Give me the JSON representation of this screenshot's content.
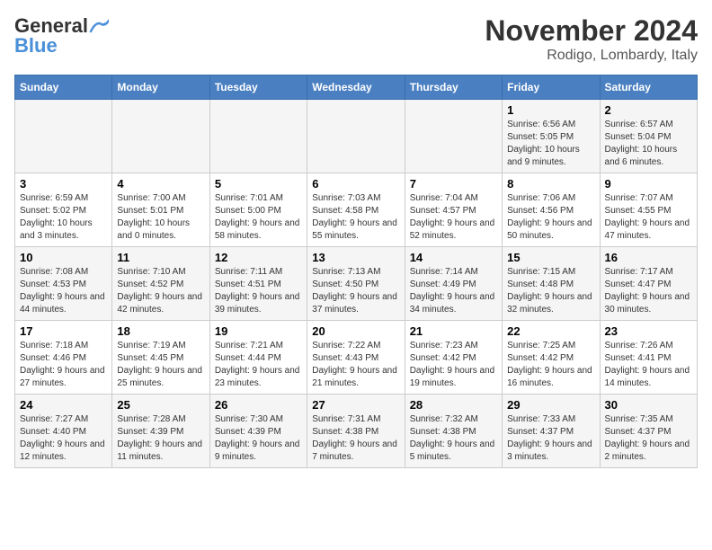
{
  "header": {
    "logo_general": "General",
    "logo_blue": "Blue",
    "month_title": "November 2024",
    "location": "Rodigo, Lombardy, Italy"
  },
  "days_of_week": [
    "Sunday",
    "Monday",
    "Tuesday",
    "Wednesday",
    "Thursday",
    "Friday",
    "Saturday"
  ],
  "weeks": [
    [
      {
        "day": "",
        "info": ""
      },
      {
        "day": "",
        "info": ""
      },
      {
        "day": "",
        "info": ""
      },
      {
        "day": "",
        "info": ""
      },
      {
        "day": "",
        "info": ""
      },
      {
        "day": "1",
        "info": "Sunrise: 6:56 AM\nSunset: 5:05 PM\nDaylight: 10 hours and 9 minutes."
      },
      {
        "day": "2",
        "info": "Sunrise: 6:57 AM\nSunset: 5:04 PM\nDaylight: 10 hours and 6 minutes."
      }
    ],
    [
      {
        "day": "3",
        "info": "Sunrise: 6:59 AM\nSunset: 5:02 PM\nDaylight: 10 hours and 3 minutes."
      },
      {
        "day": "4",
        "info": "Sunrise: 7:00 AM\nSunset: 5:01 PM\nDaylight: 10 hours and 0 minutes."
      },
      {
        "day": "5",
        "info": "Sunrise: 7:01 AM\nSunset: 5:00 PM\nDaylight: 9 hours and 58 minutes."
      },
      {
        "day": "6",
        "info": "Sunrise: 7:03 AM\nSunset: 4:58 PM\nDaylight: 9 hours and 55 minutes."
      },
      {
        "day": "7",
        "info": "Sunrise: 7:04 AM\nSunset: 4:57 PM\nDaylight: 9 hours and 52 minutes."
      },
      {
        "day": "8",
        "info": "Sunrise: 7:06 AM\nSunset: 4:56 PM\nDaylight: 9 hours and 50 minutes."
      },
      {
        "day": "9",
        "info": "Sunrise: 7:07 AM\nSunset: 4:55 PM\nDaylight: 9 hours and 47 minutes."
      }
    ],
    [
      {
        "day": "10",
        "info": "Sunrise: 7:08 AM\nSunset: 4:53 PM\nDaylight: 9 hours and 44 minutes."
      },
      {
        "day": "11",
        "info": "Sunrise: 7:10 AM\nSunset: 4:52 PM\nDaylight: 9 hours and 42 minutes."
      },
      {
        "day": "12",
        "info": "Sunrise: 7:11 AM\nSunset: 4:51 PM\nDaylight: 9 hours and 39 minutes."
      },
      {
        "day": "13",
        "info": "Sunrise: 7:13 AM\nSunset: 4:50 PM\nDaylight: 9 hours and 37 minutes."
      },
      {
        "day": "14",
        "info": "Sunrise: 7:14 AM\nSunset: 4:49 PM\nDaylight: 9 hours and 34 minutes."
      },
      {
        "day": "15",
        "info": "Sunrise: 7:15 AM\nSunset: 4:48 PM\nDaylight: 9 hours and 32 minutes."
      },
      {
        "day": "16",
        "info": "Sunrise: 7:17 AM\nSunset: 4:47 PM\nDaylight: 9 hours and 30 minutes."
      }
    ],
    [
      {
        "day": "17",
        "info": "Sunrise: 7:18 AM\nSunset: 4:46 PM\nDaylight: 9 hours and 27 minutes."
      },
      {
        "day": "18",
        "info": "Sunrise: 7:19 AM\nSunset: 4:45 PM\nDaylight: 9 hours and 25 minutes."
      },
      {
        "day": "19",
        "info": "Sunrise: 7:21 AM\nSunset: 4:44 PM\nDaylight: 9 hours and 23 minutes."
      },
      {
        "day": "20",
        "info": "Sunrise: 7:22 AM\nSunset: 4:43 PM\nDaylight: 9 hours and 21 minutes."
      },
      {
        "day": "21",
        "info": "Sunrise: 7:23 AM\nSunset: 4:42 PM\nDaylight: 9 hours and 19 minutes."
      },
      {
        "day": "22",
        "info": "Sunrise: 7:25 AM\nSunset: 4:42 PM\nDaylight: 9 hours and 16 minutes."
      },
      {
        "day": "23",
        "info": "Sunrise: 7:26 AM\nSunset: 4:41 PM\nDaylight: 9 hours and 14 minutes."
      }
    ],
    [
      {
        "day": "24",
        "info": "Sunrise: 7:27 AM\nSunset: 4:40 PM\nDaylight: 9 hours and 12 minutes."
      },
      {
        "day": "25",
        "info": "Sunrise: 7:28 AM\nSunset: 4:39 PM\nDaylight: 9 hours and 11 minutes."
      },
      {
        "day": "26",
        "info": "Sunrise: 7:30 AM\nSunset: 4:39 PM\nDaylight: 9 hours and 9 minutes."
      },
      {
        "day": "27",
        "info": "Sunrise: 7:31 AM\nSunset: 4:38 PM\nDaylight: 9 hours and 7 minutes."
      },
      {
        "day": "28",
        "info": "Sunrise: 7:32 AM\nSunset: 4:38 PM\nDaylight: 9 hours and 5 minutes."
      },
      {
        "day": "29",
        "info": "Sunrise: 7:33 AM\nSunset: 4:37 PM\nDaylight: 9 hours and 3 minutes."
      },
      {
        "day": "30",
        "info": "Sunrise: 7:35 AM\nSunset: 4:37 PM\nDaylight: 9 hours and 2 minutes."
      }
    ]
  ]
}
